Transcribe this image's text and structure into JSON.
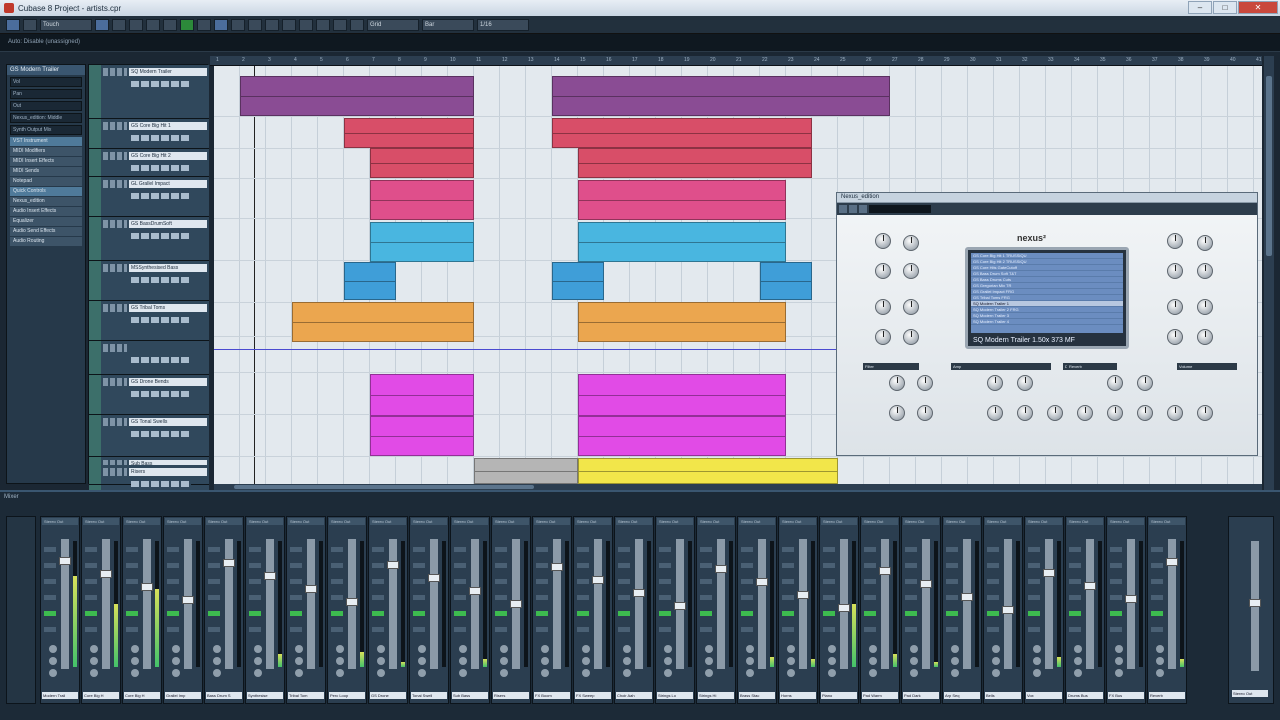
{
  "window": {
    "title": "Cubase 8 Project - artists.cpr",
    "min": "–",
    "max": "□",
    "close": "✕"
  },
  "toolbar": {
    "mode": "Touch",
    "snap": "Bar",
    "quantize": "1/16",
    "grid": "Grid"
  },
  "status": "Auto: Disable (unassigned)",
  "inspector": {
    "track_title": "GS Modern Trailer",
    "rows": [
      "Vol",
      "Pan",
      "Out"
    ],
    "midi_input": "Nexus_edition: Middle",
    "routing": "Synth Output Mix",
    "sections": [
      {
        "label": "VST Instrument",
        "hi": true
      },
      {
        "label": "MIDI Modifiers",
        "hi": false
      },
      {
        "label": "MIDI Insert Effects",
        "hi": false
      },
      {
        "label": "MIDI Sends",
        "hi": false
      },
      {
        "label": "Notepad",
        "hi": false
      },
      {
        "label": "Quick Controls",
        "hi": true
      },
      {
        "label": "Nexus_edition",
        "hi": false
      },
      {
        "label": "Audio Insert Effects",
        "hi": false
      },
      {
        "label": "Equalizer",
        "hi": false
      },
      {
        "label": "Audio Send Effects",
        "hi": false
      },
      {
        "label": "Audio Routing",
        "hi": false
      }
    ]
  },
  "tracks": [
    "SQ Modern Trailer",
    "GS Core Big Hit 1",
    "GS Core Big Hit 2",
    "GL Grallel Impact",
    "GS BassDrumSoft",
    "MSSynthesised Bass",
    "GS Tribal Toms",
    "",
    "GS Drone Bends",
    "GS Tonal Swells",
    "Sub Bass",
    "Risers"
  ],
  "ruler": [
    "1",
    "2",
    "3",
    "4",
    "5",
    "6",
    "7",
    "8",
    "9",
    "10",
    "11",
    "12",
    "13",
    "14",
    "15",
    "16",
    "17",
    "18",
    "19",
    "20",
    "21",
    "22",
    "23",
    "24",
    "25",
    "26",
    "27",
    "28",
    "29",
    "30",
    "31",
    "32",
    "33",
    "34",
    "35",
    "36",
    "37",
    "38",
    "39",
    "40",
    "41"
  ],
  "plugin": {
    "title": "Nexus_edition",
    "brand": "nexus²",
    "preset": "SQ Modern Trailer 1.50x",
    "preset_sub": "373 MF",
    "list": [
      "GS Core Big Hit 1 TRUSSIQU",
      "GS Core Big Hit 2 TRUSSIQU",
      "GS Core Hits GateCutoff",
      "GS Bass Drum Soft T&T",
      "GS Bass Drums Cuts",
      "GS Gregorian Mix TR",
      "GS Grallel Impact FRG",
      "GS Tribal Toms FRG",
      "SQ Modern Trailer 1",
      "SQ Modern Trailer 2 FRG",
      "SQ Modern Trailer 3",
      "SQ Modern Trailer 4"
    ],
    "sections": [
      "Filter",
      "Amp",
      "Delay",
      "Reverb",
      "Gater",
      "Volume"
    ]
  },
  "mixer": {
    "title": "Mixer",
    "strip_top": "Stereo Out",
    "strips": [
      "Modern Trail",
      "Core Big H",
      "Core Big H",
      "Grallel Imp",
      "Bass Drum S",
      "Synthesise",
      "Tribal Tom",
      "Perc Loop",
      "GS Drone",
      "Tonal Swell",
      "Sub Bass",
      "Risers",
      "FX Boom",
      "FX Sweep",
      "Choir Aah",
      "Strings Lo",
      "Strings Hi",
      "Brass Stac",
      "Horns",
      "Piano",
      "Pad Warm",
      "Pad Dark",
      "Arp Seq",
      "Bells",
      "Vox",
      "Drums Bus",
      "FX Bus",
      "Reverb"
    ],
    "master": "Stereo Out"
  }
}
